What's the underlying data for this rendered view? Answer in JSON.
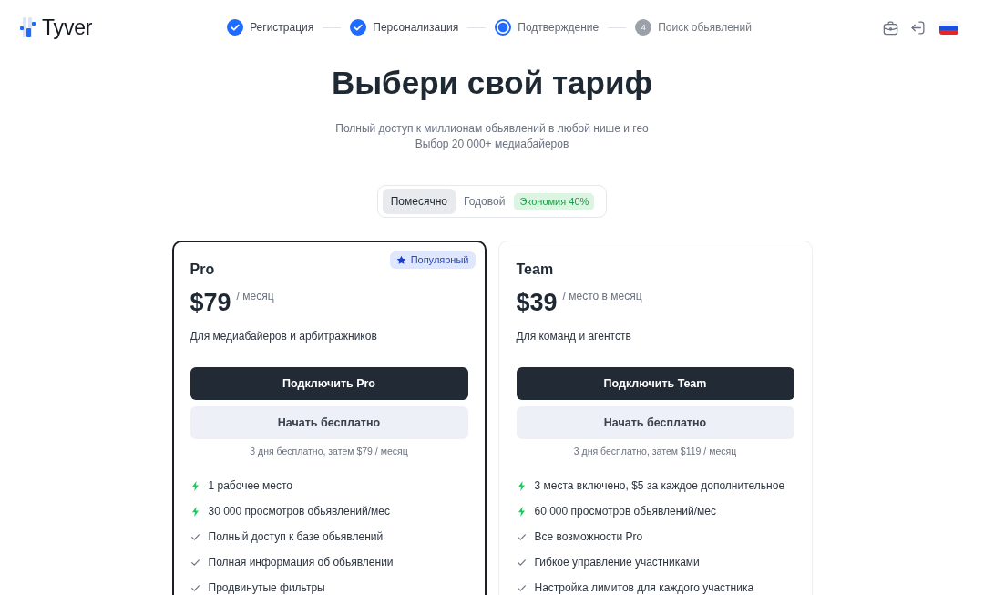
{
  "header": {
    "logo": "Tyver",
    "steps": [
      {
        "label": "Регистрация",
        "completed": true,
        "current": false
      },
      {
        "label": "Персонализация",
        "completed": true,
        "current": false
      },
      {
        "label": "Подтверждение",
        "completed": false,
        "current": true
      },
      {
        "label": "Поиск обьявлений",
        "completed": false,
        "current": false,
        "number": "4"
      }
    ]
  },
  "hero": {
    "title": "Выбери свой тариф",
    "subtitle": [
      "Полный доступ к миллионам обьявлений в любой нише и гео",
      "Выбор 20 000+ медиабайеров"
    ]
  },
  "billing": {
    "options": [
      {
        "label": "Помесячно",
        "selected": true
      },
      {
        "label": "Годовой",
        "selected": false
      }
    ],
    "discount_badge": "Экономия 40%"
  },
  "plans": [
    {
      "name": "Pro",
      "highlighted": true,
      "badge": "Популярный",
      "price": "$79",
      "period": "/ месяц",
      "description": "Для медиабайеров и арбитражников",
      "primary_button": "Подключить Pro",
      "secondary_button": "Начать бесплатно",
      "trial_note": "3 дня бесплатно, затем $79 / месяц",
      "features": [
        {
          "text": "1 рабочее место",
          "kind": "bolt"
        },
        {
          "text": "30 000 просмотров обьявлений/мес",
          "kind": "bolt"
        },
        {
          "text": "Полный доступ к базе обьявлений",
          "kind": "check"
        },
        {
          "text": "Полная информация об обьявлении",
          "kind": "check"
        },
        {
          "text": "Продвинутые фильтры",
          "kind": "check"
        }
      ]
    },
    {
      "name": "Team",
      "highlighted": false,
      "price": "$39",
      "period": "/ место в месяц",
      "description": "Для команд и агентств",
      "primary_button": "Подключить Team",
      "secondary_button": "Начать бесплатно",
      "trial_note": "3 дня бесплатно, затем $119 / месяц",
      "features": [
        {
          "text": "3 места включено, $5 за каждое дополнительное",
          "kind": "bolt"
        },
        {
          "text": "60 000 просмотров обьявлений/мес",
          "kind": "bolt"
        },
        {
          "text": "Все возможности Pro",
          "kind": "check"
        },
        {
          "text": "Гибкое управление участниками",
          "kind": "check"
        },
        {
          "text": "Настройка лимитов для каждого участника",
          "kind": "check"
        }
      ]
    }
  ]
}
